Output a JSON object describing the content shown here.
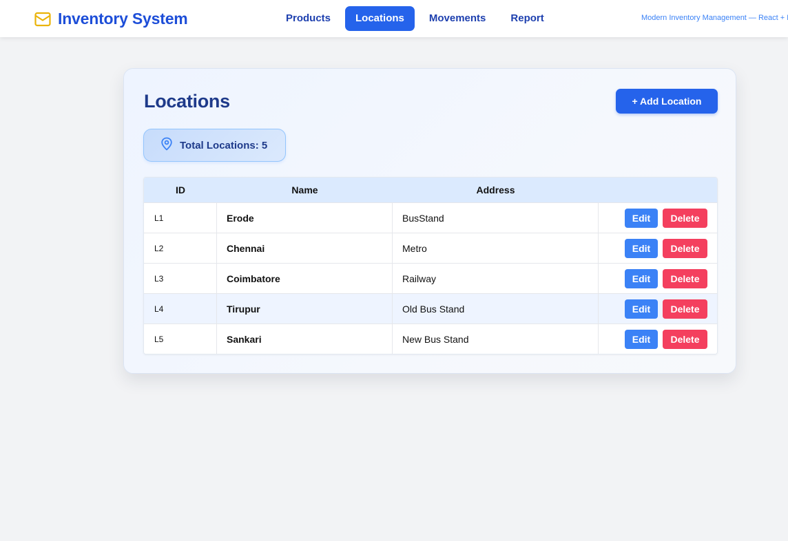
{
  "header": {
    "brand_title": "Inventory System",
    "brand_icon": "mail-box-icon",
    "nav": [
      {
        "label": "Products",
        "active": false
      },
      {
        "label": "Locations",
        "active": true
      },
      {
        "label": "Movements",
        "active": false
      },
      {
        "label": "Report",
        "active": false
      }
    ],
    "tagline": "Modern Inventory Management — React + Fla"
  },
  "page": {
    "title": "Locations",
    "add_button_label": "+ Add Location",
    "stat_icon": "map-pin-icon",
    "stat_label": "Total Locations: 5"
  },
  "table": {
    "columns": [
      "ID",
      "Name",
      "Address"
    ],
    "rows": [
      {
        "id": "L1",
        "name": "Erode",
        "address": "BusStand",
        "edit": "Edit",
        "delete": "Delete"
      },
      {
        "id": "L2",
        "name": "Chennai",
        "address": "Metro",
        "edit": "Edit",
        "delete": "Delete"
      },
      {
        "id": "L3",
        "name": "Coimbatore",
        "address": "Railway",
        "edit": "Edit",
        "delete": "Delete"
      },
      {
        "id": "L4",
        "name": "Tirupur",
        "address": "Old Bus Stand",
        "edit": "Edit",
        "delete": "Delete"
      },
      {
        "id": "L5",
        "name": "Sankari",
        "address": "New Bus Stand",
        "edit": "Edit",
        "delete": "Delete"
      }
    ]
  },
  "colors": {
    "primary": "#2563eb",
    "brand_text": "#1d4ed8",
    "heading": "#1e3a8a",
    "edit": "#3b82f6",
    "delete": "#f43f5e",
    "table_header": "#dbeafe",
    "icon_yellow": "#eab308"
  }
}
